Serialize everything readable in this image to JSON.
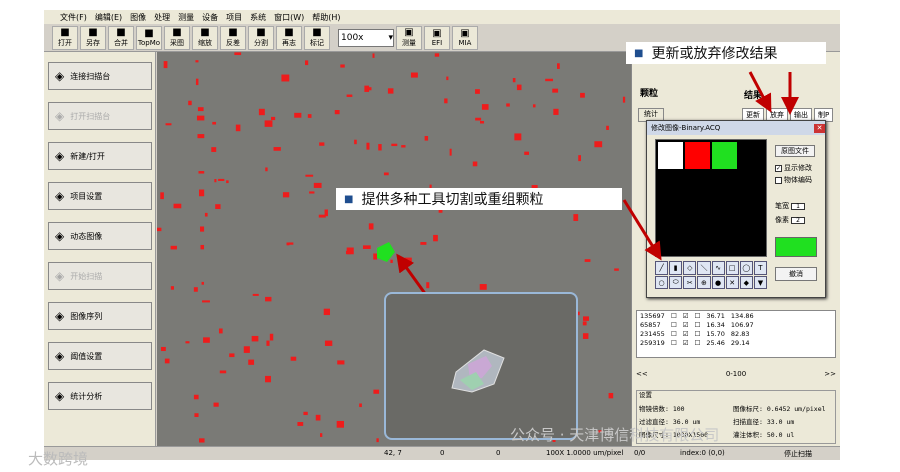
{
  "menu": [
    "文件(F)",
    "编辑(E)",
    "图像",
    "处理",
    "测量",
    "设备",
    "项目",
    "系统",
    "窗口(W)",
    "帮助(H)"
  ],
  "toolbar": [
    {
      "label": "打开",
      "icon": "open-icon"
    },
    {
      "label": "另存",
      "icon": "save-icon"
    },
    {
      "label": "合并",
      "icon": "merge-icon"
    },
    {
      "label": "TopMo",
      "icon": "topmo-icon"
    },
    {
      "label": "采图",
      "icon": "capture-icon"
    },
    {
      "label": "缩放",
      "icon": "zoom-icon"
    },
    {
      "label": "反差",
      "icon": "contrast-icon"
    },
    {
      "label": "分割",
      "icon": "split-icon"
    },
    {
      "label": "再志",
      "icon": "reshape-icon"
    },
    {
      "label": "标记",
      "icon": "flag-icon"
    }
  ],
  "zoom_select": "100x",
  "toolbar_right": [
    {
      "label": "测量",
      "icon": "measure-icon"
    },
    {
      "label": "EFI",
      "icon": "efi-icon"
    },
    {
      "label": "MIA",
      "icon": "mia-icon"
    }
  ],
  "left_buttons": [
    {
      "label": "连接扫描台",
      "disabled": false,
      "icon": "stage-icon"
    },
    {
      "label": "打开扫描台",
      "disabled": true,
      "icon": "open-stage-icon"
    },
    {
      "label": "新建/打开",
      "disabled": false,
      "icon": "new-open-icon"
    },
    {
      "label": "项目设置",
      "disabled": false,
      "icon": "project-settings-icon"
    },
    {
      "label": "动态图像",
      "disabled": false,
      "icon": "live-image-icon"
    },
    {
      "label": "开始扫描",
      "disabled": true,
      "icon": "start-scan-icon"
    },
    {
      "label": "图像序列",
      "disabled": false,
      "icon": "image-sequence-icon"
    },
    {
      "label": "阈值设置",
      "disabled": false,
      "icon": "threshold-icon"
    },
    {
      "label": "统计分析",
      "disabled": false,
      "icon": "statistics-icon"
    }
  ],
  "callouts": {
    "top": "更新或放弃修改结果",
    "mid": "提供多种工具切割或重组颗粒"
  },
  "right": {
    "title": "颗粒",
    "result": "结果",
    "stat": "统计",
    "tabs": [
      "更新",
      "放弃",
      "输出",
      "制P"
    ]
  },
  "dialog": {
    "title": "修改图像-Binary.ACQ",
    "orig_button": "原图文件",
    "chk1": "显示修改",
    "chk2": "物体编码",
    "width_label": "笔宽",
    "width_val": "1",
    "pixels_label": "像素",
    "pixels_val": "2",
    "cancel": "撤消"
  },
  "table_rows": [
    [
      "135697",
      "36.71",
      "134.86"
    ],
    [
      "65857",
      "16.34",
      "106.97"
    ],
    [
      "231455",
      "15.70",
      "82.83"
    ],
    [
      "259319",
      "25.46",
      "29.14"
    ]
  ],
  "pager": {
    "prev": "<<",
    "mid": "0-100",
    "next": ">>"
  },
  "settings": {
    "title": "设置",
    "r1l": "物镜倍数:",
    "r1v": "100",
    "r1l2": "图像标尺:",
    "r1v2": "0.6452 um/pixel",
    "r2l": "过滤直径:",
    "r2v": "36.0 um",
    "r2l2": "扫描直径:",
    "r2v2": "33.0 um",
    "r3l": "图像尺寸:",
    "r3v": "1000X1500",
    "r3l2": "灌注体积:",
    "r3v2": "50.0 ul"
  },
  "status": {
    "coord": "42, 7",
    "a": "0",
    "b": "0",
    "scale": "100X 1.0000 um/pixel",
    "c": "0/0",
    "index": "index:0 (0,0)",
    "stop": "停止扫描"
  },
  "watermark": {
    "wechat": "公众号 · 天津博信科技有限公司",
    "bottom": "大数跨境"
  },
  "colors": {
    "particle_red": "#ee1c1c",
    "particle_green": "#20e020",
    "callout_arrow": "#c00000"
  }
}
